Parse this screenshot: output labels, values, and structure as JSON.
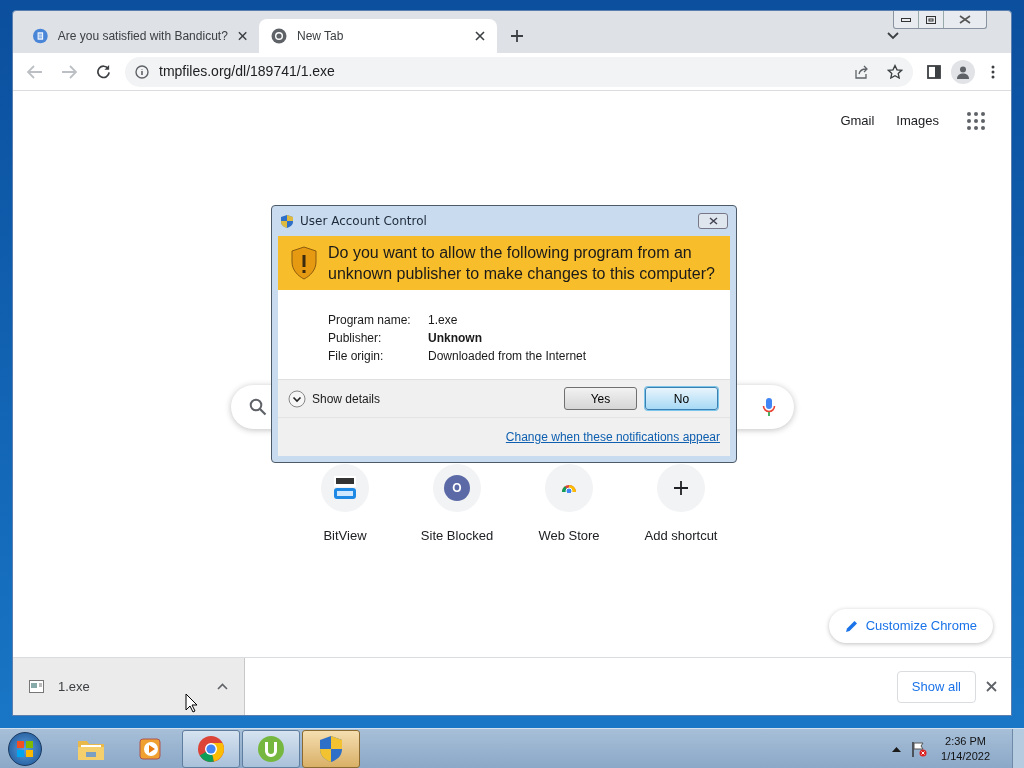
{
  "browser": {
    "tabs": [
      {
        "title": "Are you satisfied with Bandicut?",
        "kind": "site",
        "selected": false
      },
      {
        "title": "New Tab",
        "kind": "chrome",
        "selected": true
      }
    ],
    "address": "tmpfiles.org/dl/189741/1.exe",
    "top_links": [
      "Gmail",
      "Images"
    ],
    "shortcuts": [
      {
        "label": "BitView",
        "kind": "bitview"
      },
      {
        "label": "Site Blocked",
        "kind": "letter",
        "letter": "O"
      },
      {
        "label": "Web Store",
        "kind": "webstore"
      },
      {
        "label": "Add shortcut",
        "kind": "add"
      }
    ],
    "customize_button": "Customize Chrome",
    "downloads": [
      {
        "filename": "1.exe"
      }
    ],
    "show_all": "Show all"
  },
  "dialog": {
    "title": "User Account Control",
    "question": "Do you want to allow the following program from an unknown publisher to make changes to this computer?",
    "fields": [
      {
        "label": "Program name:",
        "value": "1.exe",
        "bold": false
      },
      {
        "label": "Publisher:",
        "value": "Unknown",
        "bold": true
      },
      {
        "label": "File origin:",
        "value": "Downloaded from the Internet",
        "bold": false
      }
    ],
    "details": "Show details",
    "buttons": [
      {
        "label": "Yes",
        "selected": false
      },
      {
        "label": "No",
        "selected": true
      }
    ],
    "link": "Change when these notifications appear"
  },
  "taskbar": {
    "items": [
      {
        "kind": "explorer",
        "open": false,
        "selected": false
      },
      {
        "kind": "media",
        "open": false,
        "selected": false
      },
      {
        "kind": "chrome",
        "open": true,
        "selected": false
      },
      {
        "kind": "torrent",
        "open": true,
        "selected": false
      },
      {
        "kind": "shield",
        "open": true,
        "selected": true
      }
    ],
    "time": "2:36 PM",
    "date": "1/14/2022"
  }
}
